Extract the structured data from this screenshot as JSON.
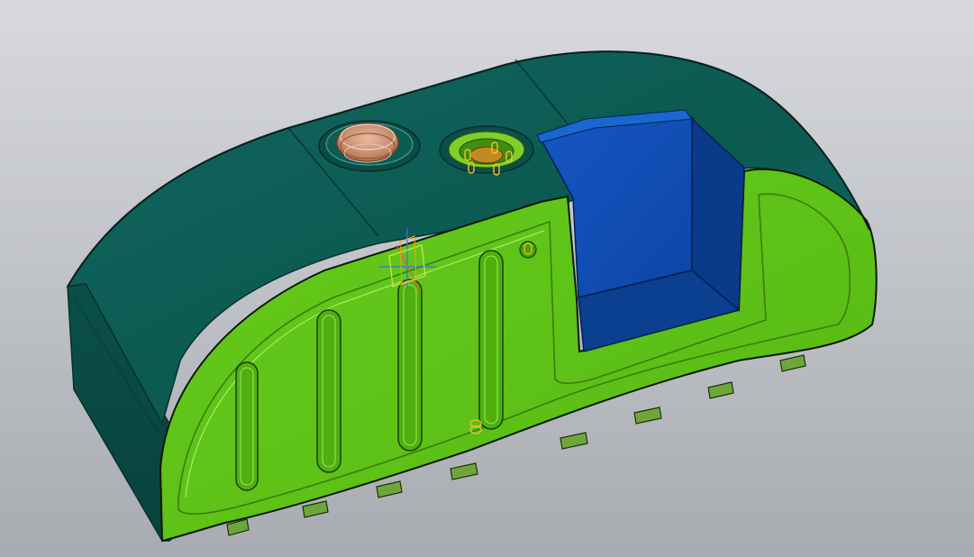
{
  "viewport": {
    "background_top": "#d6d8dc",
    "background_bottom": "#a9acb2"
  },
  "model": {
    "body_color": "#0d5a52",
    "body_top_color": "#14706a",
    "side_panel_color": "#5cc416",
    "side_panel_highlight": "#8ee04a",
    "cutout_color": "#0a3f96",
    "cutout_light_color": "#1759c4",
    "filler_cap_color": "#cc9070",
    "edge_color": "#0a0f10"
  },
  "icons": {
    "coordinate_triad": "coordinate-axis-triad",
    "filler_cap": "filler-cap",
    "sensor_flange": "sensor-flange"
  }
}
